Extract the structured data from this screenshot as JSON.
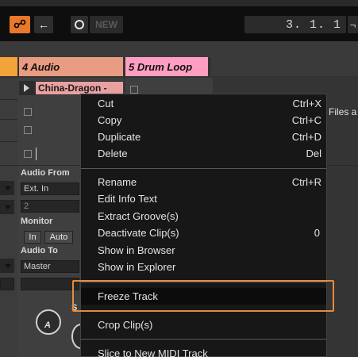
{
  "transport": {
    "link_icon": "link-icon",
    "back_glyph": "←",
    "new_label": "NEW",
    "position": "3. 1. 1"
  },
  "tracks": {
    "audio_name": "4 Audio",
    "drum_name": "5 Drum Loop"
  },
  "clip": {
    "name": "China-Dragon -"
  },
  "drop_hint": "Files a",
  "io": {
    "audio_from_label": "Audio From",
    "audio_from_value": "Ext. In",
    "channel_value": "2",
    "monitor_label": "Monitor",
    "monitor_in": "In",
    "monitor_auto": "Auto",
    "audio_to_label": "Audio To",
    "audio_to_value": "Master"
  },
  "knob_letter": "A",
  "knob_side_letter": "S",
  "context_menu": {
    "items": [
      {
        "label": "Cut",
        "shortcut": "Ctrl+X"
      },
      {
        "label": "Copy",
        "shortcut": "Ctrl+C"
      },
      {
        "label": "Duplicate",
        "shortcut": "Ctrl+D"
      },
      {
        "label": "Delete",
        "shortcut": "Del"
      },
      {
        "label": "Rename",
        "shortcut": "Ctrl+R"
      },
      {
        "label": "Edit Info Text",
        "shortcut": ""
      },
      {
        "label": "Extract Groove(s)",
        "shortcut": ""
      },
      {
        "label": "Deactivate Clip(s)",
        "shortcut": "0"
      },
      {
        "label": "Show in Browser",
        "shortcut": ""
      },
      {
        "label": "Show in Explorer",
        "shortcut": ""
      },
      {
        "label": "Freeze Track",
        "shortcut": ""
      },
      {
        "label": "Crop Clip(s)",
        "shortcut": ""
      },
      {
        "label": "Slice to New MIDI Track",
        "shortcut": ""
      }
    ]
  },
  "colors": {
    "accent_orange": "#e8782a",
    "audio_track": "#e99c82",
    "drum_track": "#ff9ec2",
    "highlight_outline": "#e88a3c"
  }
}
